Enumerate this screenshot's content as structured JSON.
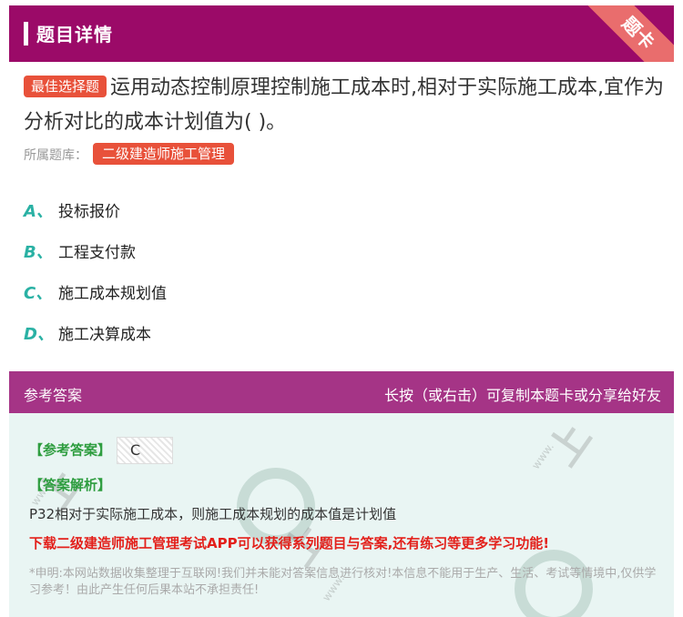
{
  "header": {
    "title": "题目详情",
    "ribbon": "题卡"
  },
  "question": {
    "type_tag": "最佳选择题",
    "text": "运用动态控制原理控制施工成本时,相对于实际施工成本,宜作为分析对比的成本计划值为( )。",
    "bank_label": "所属题库：",
    "bank_name": "二级建造师施工管理"
  },
  "options": [
    {
      "letter": "A、",
      "text": "投标报价"
    },
    {
      "letter": "B、",
      "text": "工程支付款"
    },
    {
      "letter": "C、",
      "text": "施工成本规划值"
    },
    {
      "letter": "D、",
      "text": "施工决算成本"
    }
  ],
  "answer_bar": {
    "left": "参考答案",
    "right": "长按（或右击）可复制本题卡或分享给好友"
  },
  "answer": {
    "ref_label": "【参考答案】",
    "ref_value": "C",
    "analysis_label": "【答案解析】",
    "analysis_text": "P32相对于实际施工成本，则施工成本规划的成本值是计划值",
    "promo": "下载二级建造师施工管理考试APP可以获得系列题目与答案,还有练习等更多学习功能!",
    "disclaimer": "*申明:本网站数据收集整理于互联网!我们并未能对答案信息进行核对!本信息不能用于生产、生活、考试等情境中,仅供学习参考！由此产生任何后果本站不承担责任!"
  },
  "colors": {
    "header": "#9b0a68",
    "answer_bar": "#a53486",
    "accent_red": "#e8513a",
    "option_letter": "#2ab1a4"
  }
}
